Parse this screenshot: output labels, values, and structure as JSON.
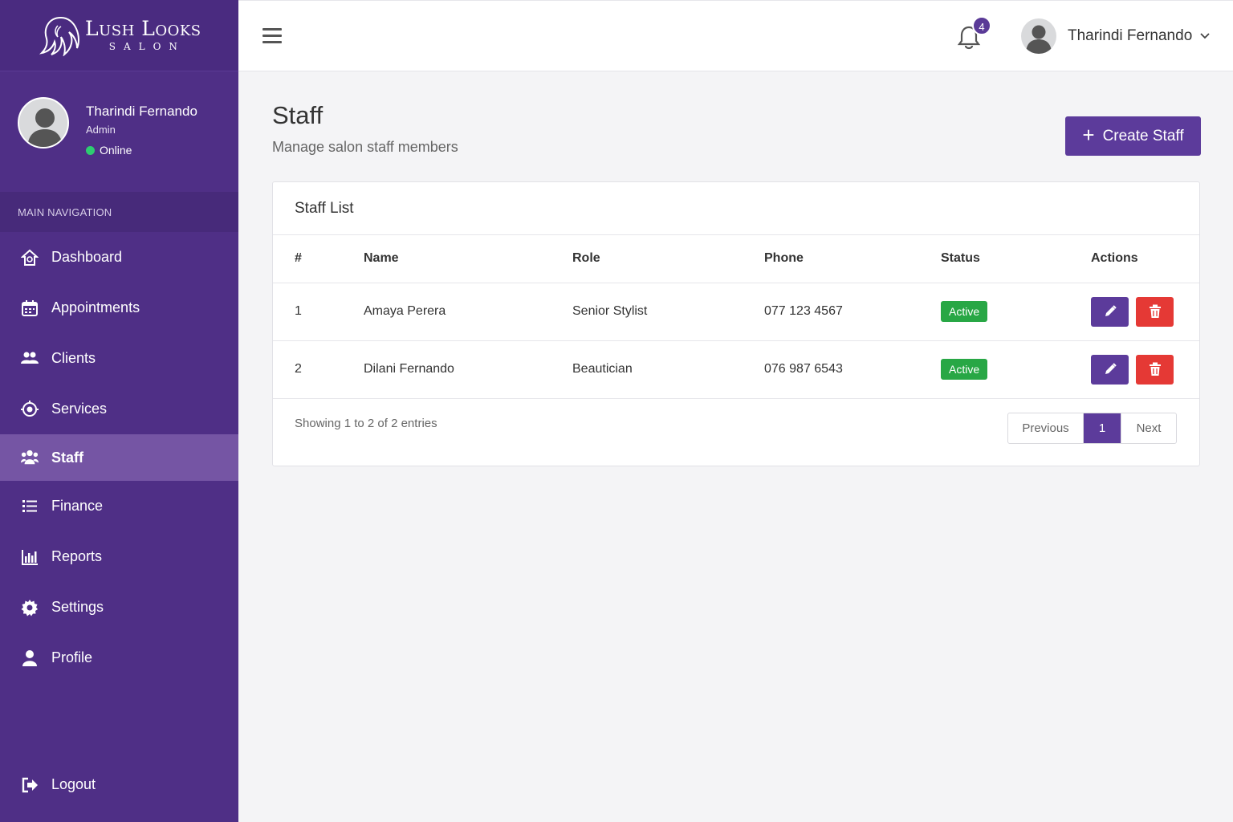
{
  "brand": {
    "name": "Lush Looks",
    "subtitle": "SALON"
  },
  "user": {
    "name": "Tharindi Fernando",
    "role": "Admin",
    "status": "Online"
  },
  "sidebar": {
    "header": "MAIN NAVIGATION",
    "items": [
      {
        "label": "Dashboard",
        "icon": "home-icon"
      },
      {
        "label": "Appointments",
        "icon": "calendar-icon"
      },
      {
        "label": "Clients",
        "icon": "users-icon"
      },
      {
        "label": "Services",
        "icon": "services-icon"
      },
      {
        "label": "Staff",
        "icon": "staff-icon",
        "active": true
      },
      {
        "label": "Finance",
        "icon": "list-icon"
      },
      {
        "label": "Reports",
        "icon": "bar-chart-icon"
      },
      {
        "label": "Settings",
        "icon": "gear-icon"
      },
      {
        "label": "Profile",
        "icon": "user-icon"
      }
    ],
    "logout": "Logout"
  },
  "topbar": {
    "notification_count": "4",
    "user_name": "Tharindi Fernando"
  },
  "page": {
    "title": "Staff",
    "subtitle": "Manage salon staff members",
    "create_button": "Create Staff"
  },
  "card": {
    "title": "Staff List",
    "columns": [
      "#",
      "Name",
      "Role",
      "Phone",
      "Status",
      "Actions"
    ],
    "rows": [
      {
        "num": "1",
        "name": "Amaya Perera",
        "role": "Senior Stylist",
        "phone": "077 123 4567",
        "status": "Active"
      },
      {
        "num": "2",
        "name": "Dilani Fernando",
        "role": "Beautician",
        "phone": "076 987 6543",
        "status": "Active"
      }
    ],
    "showing": "Showing 1 to 2 of 2 entries",
    "pagination": {
      "previous": "Previous",
      "current": "1",
      "next": "Next"
    }
  },
  "colors": {
    "sidebar": "#4f2f86",
    "accent": "#5c3b9b",
    "success": "#28a745",
    "danger": "#e53935"
  }
}
